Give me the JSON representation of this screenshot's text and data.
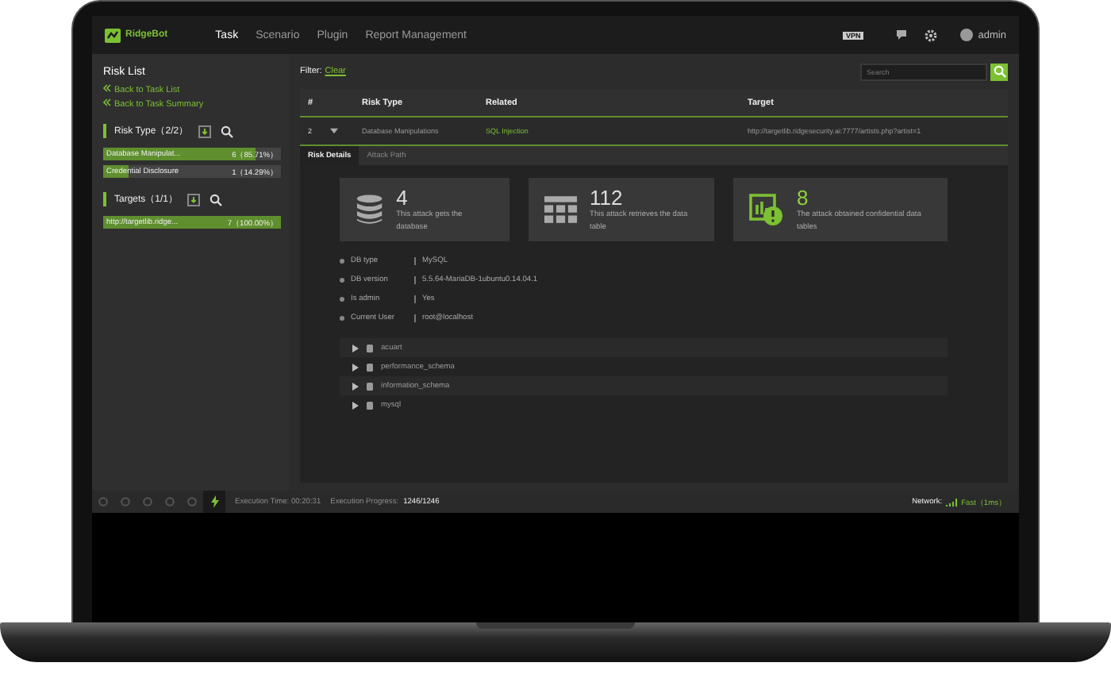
{
  "topbar": {
    "brand": "RidgeBot",
    "nav": [
      {
        "label": "Task",
        "selected": true
      },
      {
        "label": "Scenario",
        "selected": false
      },
      {
        "label": "Plugin",
        "selected": false
      },
      {
        "label": "Report Management",
        "selected": false
      }
    ],
    "vpn": "VPN",
    "user": "admin"
  },
  "sidebar": {
    "title": "Risk List",
    "links": [
      "Back to Task List",
      "Back to Task Summary"
    ],
    "groups": [
      {
        "title": "Risk Type（2/2）",
        "items": [
          {
            "name": "Database Manipulat...",
            "count": "6（85.71%）",
            "level": 0.857
          },
          {
            "name": "Credential Disclosure",
            "count": "1（14.29%）",
            "level": 0.143
          }
        ]
      },
      {
        "title": "Targets（1/1）",
        "items": [
          {
            "name": "http://targetlib.ridge...",
            "count": "7（100.00%）",
            "level": 1.0
          }
        ]
      }
    ]
  },
  "filter": {
    "label": "Filter:",
    "clear": "Clear",
    "search_placeholder": "Search"
  },
  "table": {
    "columns": [
      "#",
      "Risk Type",
      "Related",
      "Target"
    ],
    "rows": [
      {
        "index": "2",
        "expanded": true,
        "risk_type": "Database Manipulations",
        "related": "SQL Injection",
        "target": "http://targetlib.ridgesecurity.ai:7777/artists.php?artist=1"
      }
    ]
  },
  "detail_tabs": [
    {
      "label": "Risk Details",
      "selected": true
    },
    {
      "label": "Attack Path",
      "selected": false
    }
  ],
  "stats": [
    {
      "kind": "database",
      "value": "4",
      "text": "This attack gets the database",
      "highlight": false
    },
    {
      "kind": "table",
      "value": "112",
      "text": "This attack retrieves the data table",
      "highlight": false
    },
    {
      "kind": "alert",
      "value": "8",
      "text": "The attack obtained confidential data tables",
      "highlight": true
    }
  ],
  "info": [
    {
      "label": "DB type",
      "value": "MySQL"
    },
    {
      "label": "DB version",
      "value": "5.5.64-MariaDB-1ubuntu0.14.04.1"
    },
    {
      "label": "Is admin",
      "value": "Yes"
    },
    {
      "label": "Current User",
      "value": "root@localhost"
    }
  ],
  "databases": [
    "acuart",
    "performance_schema",
    "information_schema",
    "mysql"
  ],
  "status_bar": {
    "tools": [
      {
        "selected": false
      },
      {
        "selected": false
      },
      {
        "selected": false
      },
      {
        "selected": false
      },
      {
        "selected": false
      },
      {
        "selected": true
      }
    ],
    "time": "Execution Time: 00:20:31",
    "progress_label": "Execution Progress:",
    "progress": "1246/1246",
    "network_label": "Network:",
    "network": "Fast（1ms）"
  }
}
